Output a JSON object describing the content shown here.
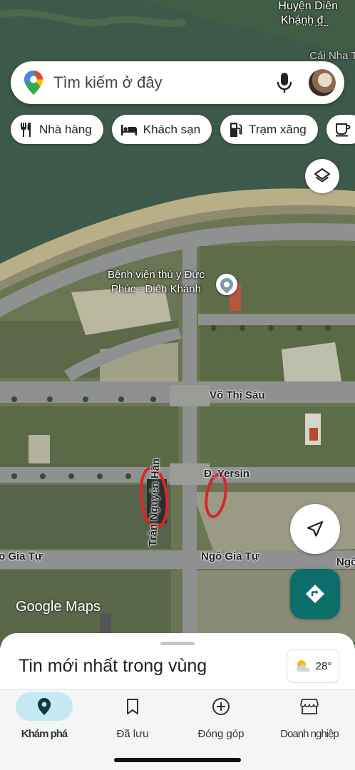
{
  "map": {
    "labels": {
      "region_top": "Huyện Diên",
      "region_second": "Khá̤n̤h̤ ̤đ̤̤ ̤",
      "nha_trang": "Cái Nha Tr",
      "poi_name": "Bệnh viện thú y Đức Phúc - Diên Khánh",
      "road_vothisau": "Võ Thị Sáu",
      "road_yersin": "Đ. Yersin",
      "road_ngogiatu_left": "o Gia Tự",
      "road_ngogiatu_right": "Ngô Gia Tự",
      "road_ngogiatu_far": "Ngô",
      "road_trannguyenhan": "Trần Nguyên Hãn"
    },
    "logo": "Google Maps"
  },
  "search": {
    "placeholder": "Tìm kiếm ở đây",
    "icons": [
      "google-maps-pin-icon",
      "microphone-icon",
      "profile-avatar"
    ]
  },
  "chips": [
    {
      "label": "Nhà hàng",
      "icon": "restaurant-icon"
    },
    {
      "label": "Khách sạn",
      "icon": "hotel-icon"
    },
    {
      "label": "Trạm xăng",
      "icon": "gas-station-icon"
    },
    {
      "label": "",
      "icon": "coffee-icon"
    }
  ],
  "sheet": {
    "title": "Tin mới nhất trong vùng",
    "weather": {
      "temperature": "28°",
      "icon": "partly-cloudy-icon"
    }
  },
  "nav": {
    "items": [
      {
        "label": "Khám phá",
        "icon": "explore-pin-icon",
        "active": true
      },
      {
        "label": "Đã lưu",
        "icon": "bookmark-icon",
        "active": false
      },
      {
        "label": "Đóng góp",
        "icon": "add-circle-icon",
        "active": false
      },
      {
        "label": "Doanh nghiệp",
        "icon": "storefront-icon",
        "active": false
      }
    ]
  },
  "colors": {
    "river": "#3f5a48",
    "accent_teal": "#0b6e6b",
    "annotation_red": "#d8262c",
    "nav_active": "#c5e9f3"
  }
}
